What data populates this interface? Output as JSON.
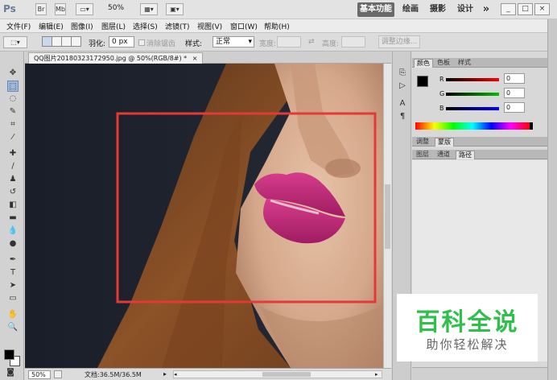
{
  "app": {
    "logo": "Ps",
    "titlebar": {
      "zoom": "50%",
      "workspaces": [
        "基本功能",
        "绘画",
        "摄影",
        "设计"
      ],
      "more": "»",
      "win_buttons": [
        "_",
        "□",
        "×"
      ]
    }
  },
  "menu": {
    "items": [
      "文件(F)",
      "编辑(E)",
      "图像(I)",
      "图层(L)",
      "选择(S)",
      "滤镜(T)",
      "视图(V)",
      "窗口(W)",
      "帮助(H)"
    ]
  },
  "options": {
    "feather_label": "羽化:",
    "feather_value": "0 px",
    "antialias_label": "消除锯齿",
    "style_label": "样式:",
    "style_value": "正常",
    "width_label": "宽度:",
    "height_label": "高度:",
    "refine_edge_label": "调整边缘..."
  },
  "document": {
    "tab_title": "QQ图片20180323172950.jpg @ 50%(RGB/8#) *",
    "tab_close": "×",
    "zoom": "50%",
    "doc_size": "文档:36.5M/36.5M"
  },
  "panels": {
    "color_tabs": [
      "颜色",
      "色板",
      "样式"
    ],
    "channels": [
      {
        "label": "R",
        "value": "0"
      },
      {
        "label": "G",
        "value": "0"
      },
      {
        "label": "B",
        "value": "0"
      }
    ],
    "adjust_tabs": [
      "调整",
      "蒙版"
    ],
    "layer_tabs": [
      "图层",
      "通道",
      "路径"
    ]
  },
  "watermark": {
    "title": "百科全说",
    "subtitle": "助你轻松解决"
  },
  "colors": {
    "selection_rect": "#e53935",
    "accent_green": "#2ec04a",
    "foreground": "#000000",
    "background": "#ffffff"
  }
}
